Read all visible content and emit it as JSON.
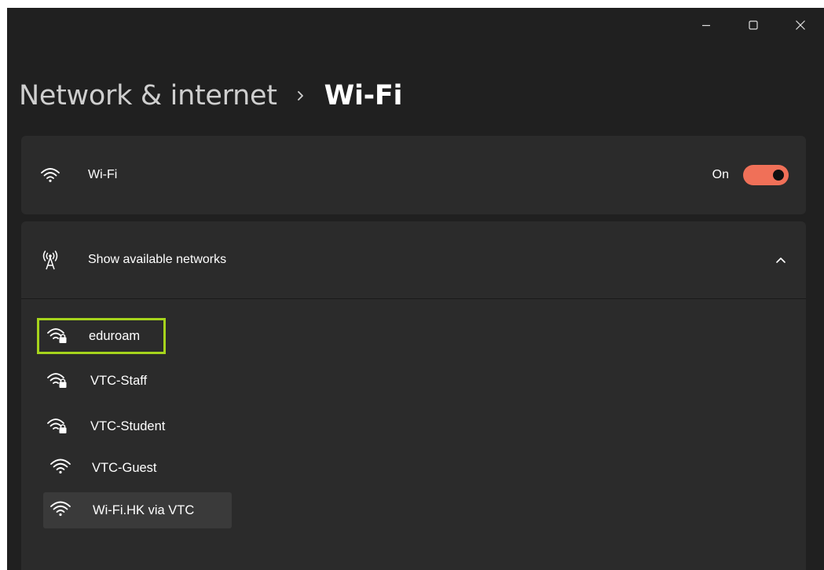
{
  "window": {
    "controls": {
      "minimize_icon": "minimize-icon",
      "maximize_icon": "maximize-icon",
      "close_icon": "close-icon"
    }
  },
  "breadcrumb": {
    "parent": "Network & internet",
    "separator_icon": "chevron-right-icon",
    "current": "Wi-Fi"
  },
  "wifi_toggle": {
    "label": "Wi-Fi",
    "state_label": "On",
    "icon": "wifi-icon",
    "accent_color": "#f07058"
  },
  "available_networks": {
    "label": "Show available networks",
    "icon": "antenna-icon",
    "expand_icon": "chevron-up-icon",
    "networks": [
      {
        "name": "eduroam",
        "secured": true,
        "highlighted": true
      },
      {
        "name": "VTC-Staff",
        "secured": true
      },
      {
        "name": "VTC-Student",
        "secured": true
      },
      {
        "name": "VTC-Guest",
        "secured": false
      },
      {
        "name": "Wi-Fi.HK via VTC",
        "secured": false,
        "hovered": true
      }
    ]
  },
  "colors": {
    "highlight_border": "#a6d41c",
    "background": "#202020",
    "card": "#2b2b2b"
  }
}
